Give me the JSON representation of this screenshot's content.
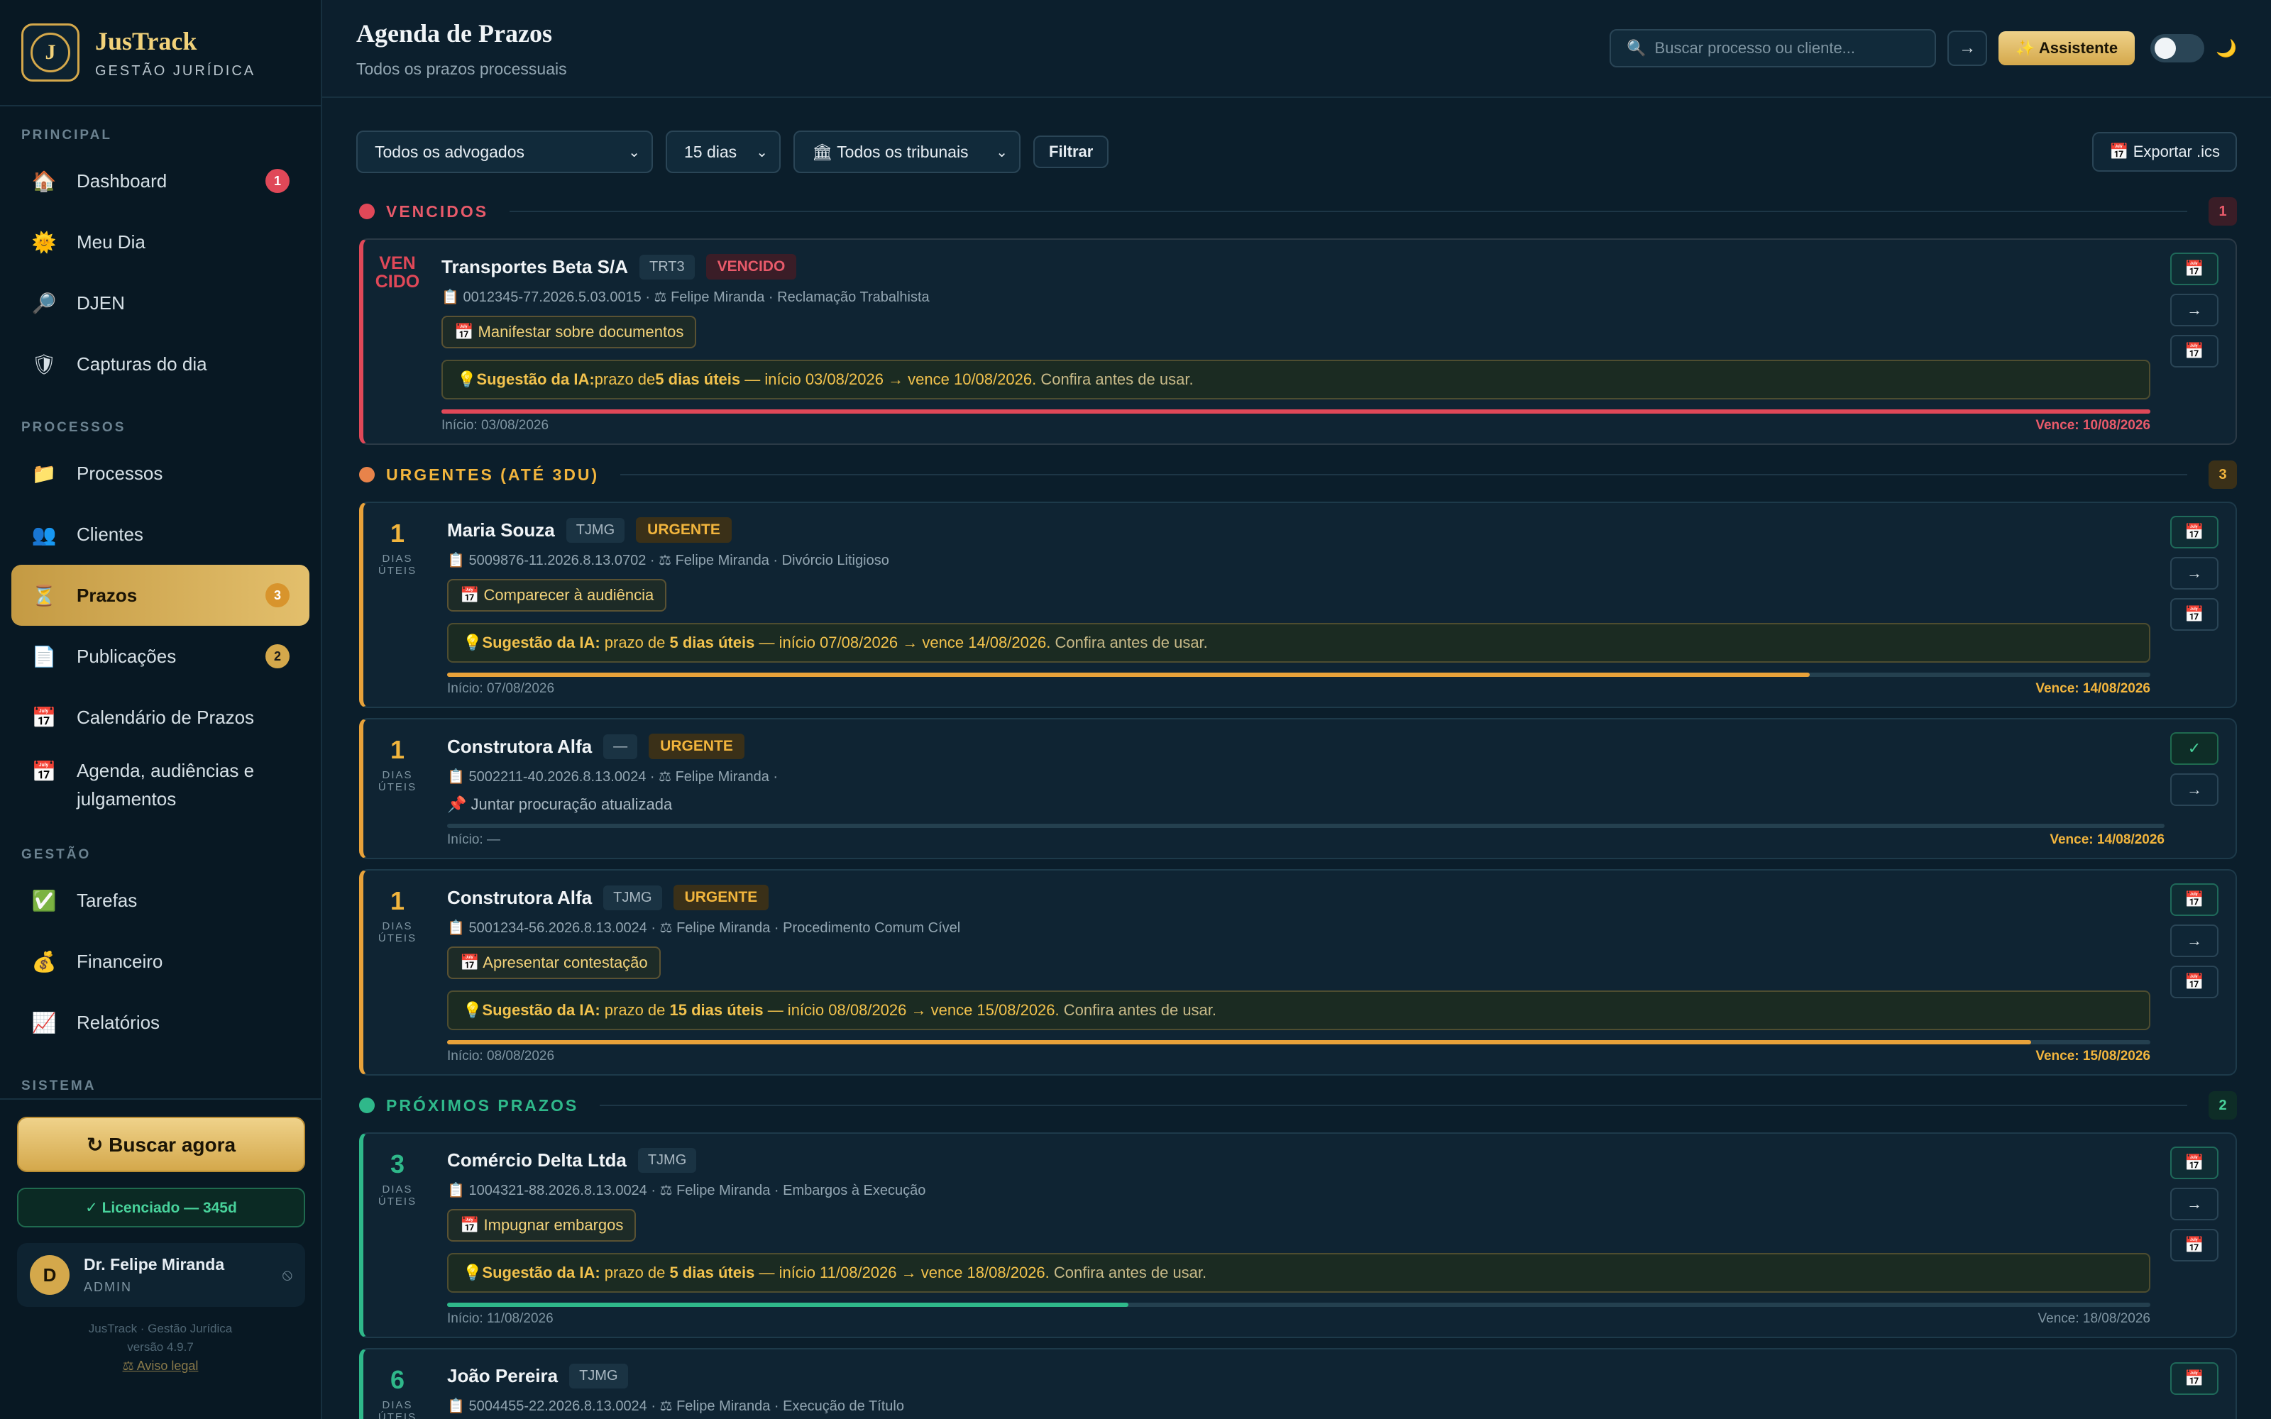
{
  "brand": {
    "name": "JusTrack",
    "subtitle": "GESTÃO JURÍDICA",
    "logo_letter": "J"
  },
  "sidebar": {
    "sections": [
      {
        "label": "PRINCIPAL",
        "items": [
          {
            "label": "Dashboard",
            "icon": "🏠",
            "badge": "1"
          },
          {
            "label": "Meu Dia",
            "icon": "🌞"
          },
          {
            "label": "DJEN",
            "icon": "🔎"
          },
          {
            "label": "Capturas do dia",
            "icon": "🛡"
          }
        ]
      },
      {
        "label": "PROCESSOS",
        "items": [
          {
            "label": "Processos",
            "icon": "📁"
          },
          {
            "label": "Clientes",
            "icon": "👥"
          },
          {
            "label": "Prazos",
            "icon": "⏳",
            "badge": "3",
            "active": true
          },
          {
            "label": "Publicações",
            "icon": "📄",
            "badge": "2"
          },
          {
            "label": "Calendário de Prazos",
            "icon": "📅"
          },
          {
            "label": "Agenda, audiências e julgamentos",
            "icon": "📅"
          }
        ]
      },
      {
        "label": "GESTÃO",
        "items": [
          {
            "label": "Tarefas",
            "icon": "✅"
          },
          {
            "label": "Financeiro",
            "icon": "💰"
          },
          {
            "label": "Relatórios",
            "icon": "📈"
          }
        ]
      },
      {
        "label": "SISTEMA",
        "items": []
      }
    ],
    "buscar_label": "↻  Buscar agora",
    "license_label": "✓ Licenciado — 345d",
    "user": {
      "initial": "D",
      "name": "Dr. Felipe Miranda",
      "role": "ADMIN",
      "logout_icon": "⦸"
    },
    "footer_line1": "JusTrack · Gestão Jurídica",
    "footer_line2": "versão 4.9.7",
    "footer_link": "⚖ Aviso legal"
  },
  "header": {
    "title": "Agenda de Prazos",
    "subtitle": "Todos os prazos processuais",
    "search_placeholder": "Buscar processo ou cliente...",
    "search_icon": "🔍",
    "go_label": "→",
    "assistant_label": "✨ Assistente",
    "moon_icon": "🌙"
  },
  "filters": {
    "advogado": "Todos os advogados",
    "periodo": "15 dias",
    "tribunal": "🏛 Todos os tribunais",
    "filter_label": "Filtrar",
    "export_label": "📅 Exportar .ics"
  },
  "sections": {
    "vencidos": {
      "label": "VENCIDOS",
      "count": "1",
      "color": "#e04858"
    },
    "urgentes": {
      "label": "URGENTES (ATÉ 3DU)",
      "count": "3",
      "color": "#e8a23a"
    },
    "proximos": {
      "label": "PRÓXIMOS PRAZOS",
      "count": "2",
      "color": "#2fb88a"
    }
  },
  "cards": [
    {
      "days": "VEN\nCIDO",
      "client": "Transportes Beta S/A",
      "court": "TRT3",
      "status": "VENCIDO",
      "meta": "📋 0012345-77.2026.5.03.0015 · ⚖ Felipe Miranda · Reclamação Trabalhista",
      "task": "📅 Manifestar sobre documentos",
      "ai_prefix": "💡 ",
      "ai_label": "Sugestão da IA:",
      "ai_mid": " prazo de ",
      "ai_days": "5 dias úteis",
      "ai_dates": " — início 03/08/2026 → vence 10/08/2026.",
      "ai_tail": " Confira antes de usar.",
      "start": "Início: 03/08/2026",
      "due": "Vence: 10/08/2026",
      "progress": 1.0
    },
    {
      "days": "1",
      "days_label": "DIAS ÚTEIS",
      "client": "Maria Souza",
      "court": "TJMG",
      "status": "URGENTE",
      "meta": "📋 5009876-11.2026.8.13.0702 · ⚖ Felipe Miranda · Divórcio Litigioso",
      "task": "📅 Comparecer à audiência",
      "ai_prefix": "💡 ",
      "ai_label": "Sugestão da IA:",
      "ai_mid": " prazo de ",
      "ai_days": "5 dias úteis",
      "ai_dates": " — início 07/08/2026 → vence 14/08/2026.",
      "ai_tail": " Confira antes de usar.",
      "start": "Início: 07/08/2026",
      "due": "Vence: 14/08/2026",
      "progress": 0.8
    },
    {
      "days": "1",
      "days_label": "DIAS ÚTEIS",
      "client": "Construtora Alfa",
      "court": "—",
      "status": "URGENTE",
      "meta": "📋 5002211-40.2026.8.13.0024 · ⚖ Felipe Miranda ·",
      "note": "📌 Juntar procuração atualizada",
      "start": "Início: —",
      "due": "Vence: 14/08/2026",
      "progress": 0.0
    },
    {
      "days": "1",
      "days_label": "DIAS ÚTEIS",
      "client": "Construtora Alfa",
      "court": "TJMG",
      "status": "URGENTE",
      "meta": "📋 5001234-56.2026.8.13.0024 · ⚖ Felipe Miranda · Procedimento Comum Cível",
      "task": "📅 Apresentar contestação",
      "ai_prefix": "💡 ",
      "ai_label": "Sugestão da IA:",
      "ai_mid": " prazo de ",
      "ai_days": "15 dias úteis",
      "ai_dates": " — início 08/08/2026 → vence 15/08/2026.",
      "ai_tail": " Confira antes de usar.",
      "start": "Início: 08/08/2026",
      "due": "Vence: 15/08/2026",
      "progress": 0.93
    },
    {
      "days": "3",
      "days_label": "DIAS ÚTEIS",
      "client": "Comércio Delta Ltda",
      "court": "TJMG",
      "meta": "📋 1004321-88.2026.8.13.0024 · ⚖ Felipe Miranda · Embargos à Execução",
      "task": "📅 Impugnar embargos",
      "ai_prefix": "💡 ",
      "ai_label": "Sugestão da IA:",
      "ai_mid": " prazo de ",
      "ai_days": "5 dias úteis",
      "ai_dates": " — início 11/08/2026 → vence 18/08/2026.",
      "ai_tail": " Confira antes de usar.",
      "start": "Início: 11/08/2026",
      "due": "Vence: 18/08/2026",
      "progress": 0.4
    },
    {
      "days": "6",
      "days_label": "DIAS ÚTEIS",
      "client": "João Pereira",
      "court": "TJMG",
      "meta": "📋 5004455-22.2026.8.13.0024 · ⚖ Felipe Miranda · Execução de Título"
    }
  ],
  "action_icons": {
    "task": "📅",
    "go": "→",
    "calendar": "📅",
    "check": "✓"
  }
}
